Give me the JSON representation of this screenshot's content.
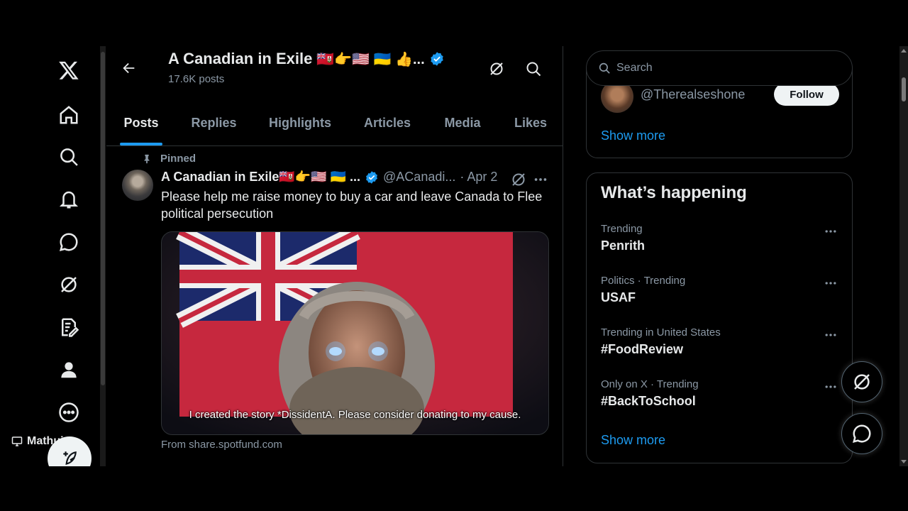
{
  "left_nav": {
    "items": [
      {
        "name": "x-logo-icon"
      },
      {
        "name": "home-icon"
      },
      {
        "name": "search-icon"
      },
      {
        "name": "notifications-icon"
      },
      {
        "name": "messages-icon"
      },
      {
        "name": "grok-icon"
      },
      {
        "name": "articles-icon"
      },
      {
        "name": "profile-icon"
      },
      {
        "name": "more-icon"
      }
    ],
    "device_label": "Mathuin"
  },
  "header": {
    "title": "A Canadian in Exile",
    "title_suffix": "🇧🇲👉🇺🇸 🇺🇦 👍...",
    "post_count": "17.6K posts"
  },
  "tabs": [
    "Posts",
    "Replies",
    "Highlights",
    "Articles",
    "Media",
    "Likes"
  ],
  "active_tab": "Posts",
  "post": {
    "pinned_label": "Pinned",
    "author_name": "A Canadian in Exile🇧🇲👉🇺🇸 🇺🇦 ...",
    "handle": "@ACanadi...",
    "date": "· Apr 2",
    "text": "Please help me raise money to buy a car and leave Canada to Flee political persecution",
    "media_caption": "I created the story *DissidentA. Please consider donating to my cause.",
    "source": "From share.spotfund.com"
  },
  "search": {
    "placeholder": "Search"
  },
  "who_to_follow": {
    "handle": "@Therealseshone",
    "follow_label": "Follow",
    "show_more": "Show more"
  },
  "whats_happening": {
    "title": "What’s happening",
    "trends": [
      {
        "meta": "Trending",
        "topic": "Penrith"
      },
      {
        "meta": "Politics · Trending",
        "topic": "USAF"
      },
      {
        "meta": "Trending in United States",
        "topic": "#FoodReview"
      },
      {
        "meta": "Only on X · Trending",
        "topic": "#BackToSchool"
      }
    ],
    "show_more": "Show more"
  },
  "colors": {
    "accent": "#1d9bf0",
    "background": "#000000",
    "text_secondary": "#8b98a5",
    "border": "#2f3336"
  }
}
